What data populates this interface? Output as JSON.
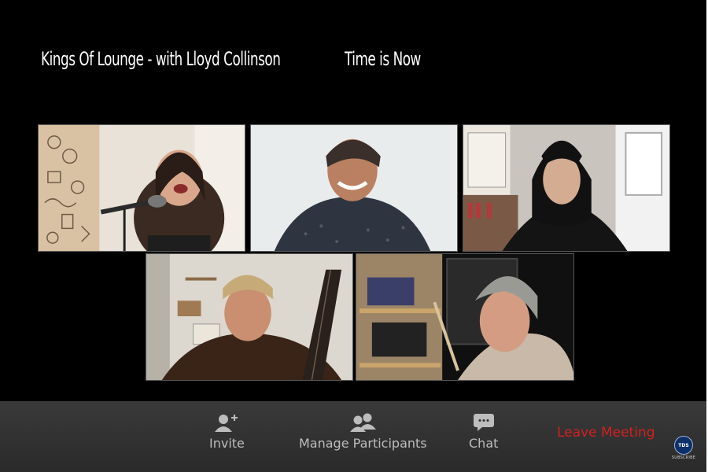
{
  "meeting": {
    "title": "Kings Of Lounge - with Lloyd Collinson",
    "subtitle": "Time is Now"
  },
  "participants": [
    {
      "id": "p1",
      "name": "singer-woman-with-microphone"
    },
    {
      "id": "p2",
      "name": "smiling-man"
    },
    {
      "id": "p3",
      "name": "long-haired-man"
    },
    {
      "id": "p4",
      "name": "guitarist"
    },
    {
      "id": "p5",
      "name": "drummer"
    }
  ],
  "toolbar": {
    "invite_label": "Invite",
    "manage_label": "Manage Participants",
    "chat_label": "Chat",
    "leave_label": "Leave Meeting",
    "leave_color": "#d32020",
    "text_color": "#bdbdbd"
  },
  "badge": {
    "logo_text": "TDS",
    "caption": "SUBSCRIBE"
  },
  "icons": {
    "invite": "add-person-icon",
    "manage": "participants-icon",
    "chat": "chat-bubble-icon"
  }
}
